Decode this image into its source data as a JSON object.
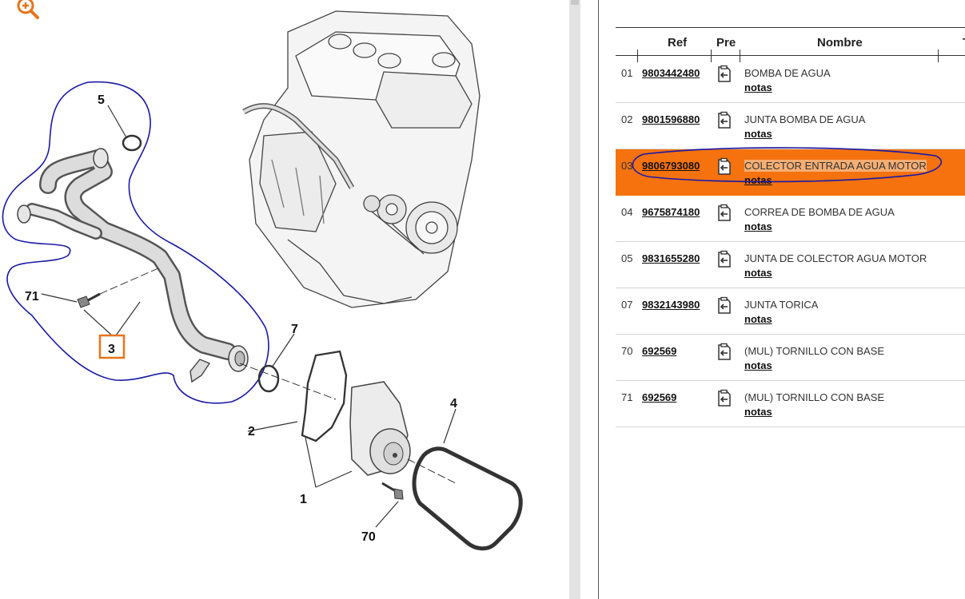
{
  "diagram": {
    "callouts": [
      "5",
      "71",
      "3",
      "7",
      "2",
      "4",
      "1",
      "70"
    ]
  },
  "table": {
    "headers": {
      "ref": "Ref",
      "pre": "Pre",
      "nombre": "Nombre",
      "cut": "T"
    },
    "rows": [
      {
        "num": "01",
        "ref": "9803442480",
        "name": "BOMBA DE AGUA",
        "notes": "notas"
      },
      {
        "num": "02",
        "ref": "9801596880",
        "name": "JUNTA BOMBA DE AGUA",
        "notes": "notas"
      },
      {
        "num": "03",
        "ref": "9806793080",
        "name": "COLECTOR ENTRADA AGUA MOTOR",
        "notes": "notas"
      },
      {
        "num": "04",
        "ref": "9675874180",
        "name": "CORREA DE BOMBA DE AGUA",
        "notes": "notas"
      },
      {
        "num": "05",
        "ref": "9831655280",
        "name": "JUNTA DE COLECTOR AGUA MOTOR",
        "notes": "notas"
      },
      {
        "num": "07",
        "ref": "9832143980",
        "name": "JUNTA TORICA",
        "notes": "notas"
      },
      {
        "num": "70",
        "ref": "692569",
        "name": "(MUL) TORNILLO CON BASE",
        "notes": "notas"
      },
      {
        "num": "71",
        "ref": "692569",
        "name": "(MUL) TORNILLO CON BASE",
        "notes": "notas"
      }
    ]
  },
  "selected_row": "03",
  "colors": {
    "selection": "#f5720f",
    "highlight": "#f6ae73",
    "annotation": "#1a1aa6",
    "zoom_icon": "#e8731c"
  },
  "icons": {
    "zoom": "zoom-in-icon",
    "pre": "document-arrow-icon"
  }
}
